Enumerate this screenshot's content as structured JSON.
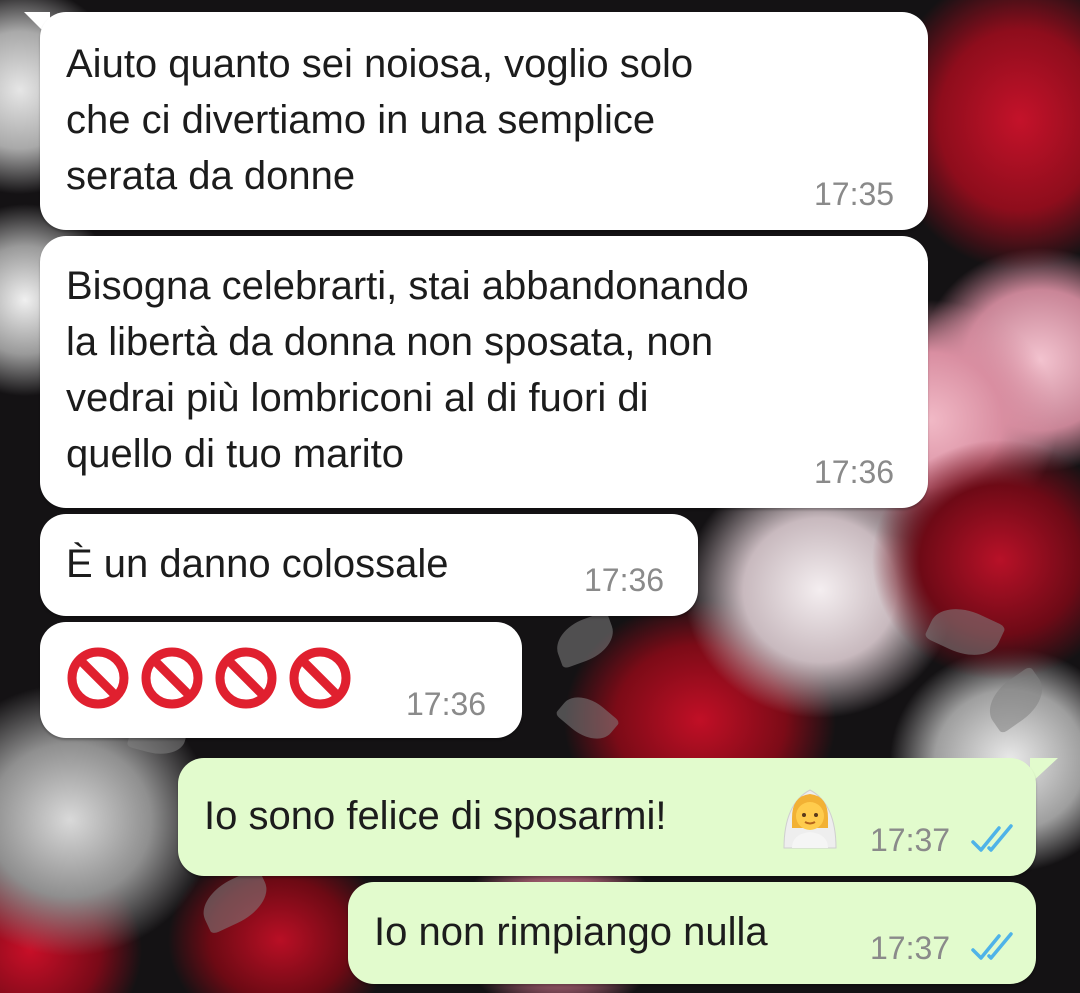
{
  "chat": {
    "messages": [
      {
        "direction": "incoming",
        "text": "Aiuto quanto sei noiosa, voglio solo\nche ci divertiamo in una semplice\nserata da donne",
        "time": "17:35"
      },
      {
        "direction": "incoming",
        "text": "Bisogna celebrarti, stai abbandonando\nla libertà da donna non sposata, non\nvedrai più lombriconi al di fuori di\nquello di tuo marito",
        "time": "17:36"
      },
      {
        "direction": "incoming",
        "text": "È un danno colossale",
        "time": "17:36"
      },
      {
        "direction": "incoming",
        "text": "",
        "emoji": [
          "prohibited-icon",
          "prohibited-icon",
          "prohibited-icon",
          "prohibited-icon"
        ],
        "time": "17:36"
      },
      {
        "direction": "outgoing",
        "text": "Io sono felice di sposarmi!",
        "emoji": [
          "bride-with-veil-icon"
        ],
        "time": "17:37",
        "status": "read-double-check-icon"
      },
      {
        "direction": "outgoing",
        "text": "Io non rimpiango nulla",
        "time": "17:37",
        "status": "read-double-check-icon"
      }
    ]
  },
  "colors": {
    "incoming_bubble": "#ffffff",
    "outgoing_bubble": "#e2fbcd",
    "read_ticks": "#4fb3e8",
    "timestamp": "#8a8a8a"
  }
}
